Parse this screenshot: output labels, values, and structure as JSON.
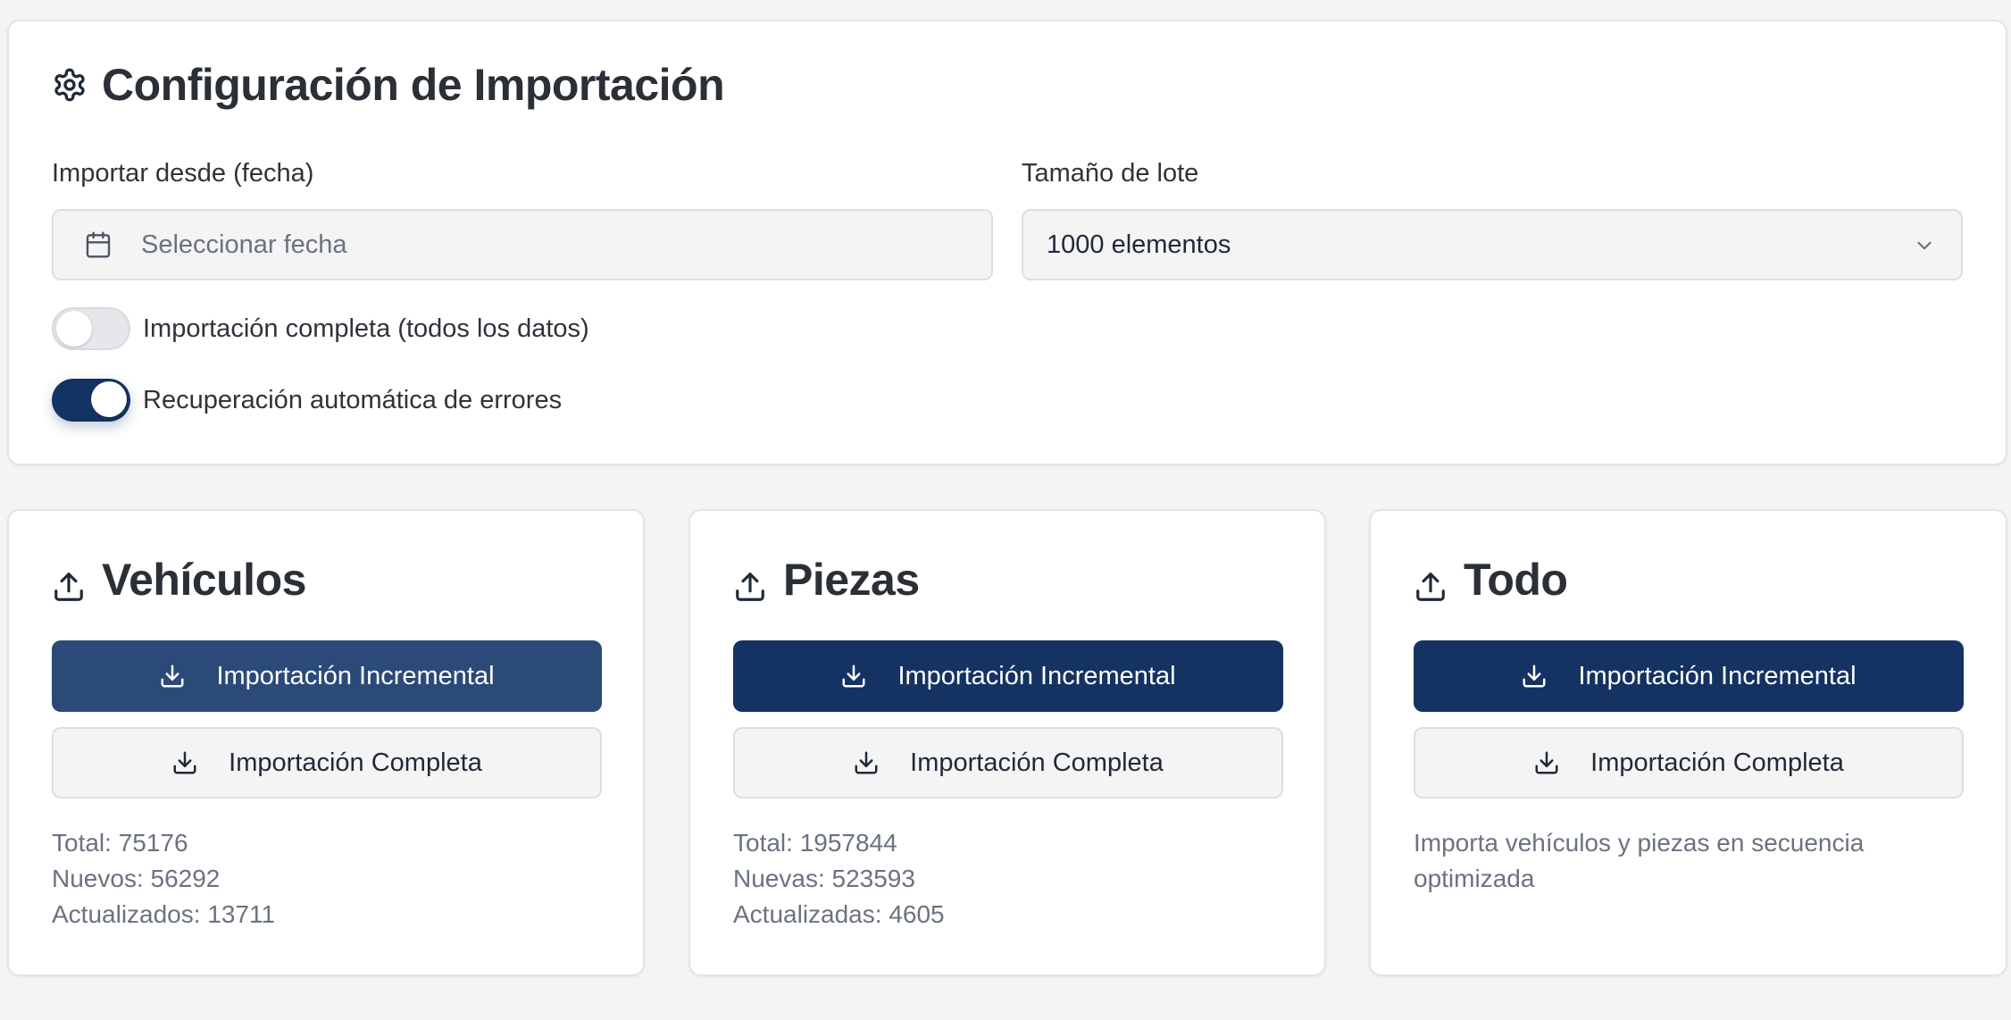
{
  "config": {
    "title": "Configuración de Importación",
    "date_label": "Importar desde (fecha)",
    "date_placeholder": "Seleccionar fecha",
    "batch_label": "Tamaño de lote",
    "batch_value": "1000 elementos",
    "toggle_full": {
      "label": "Importación completa (todos los datos)",
      "on": false
    },
    "toggle_recovery": {
      "label": "Recuperación automática de errores",
      "on": true
    }
  },
  "cards": {
    "vehiculos": {
      "title": "Vehículos",
      "incremental_label": "Importación Incremental",
      "full_label": "Importación Completa",
      "stats": [
        "Total: 75176",
        "Nuevos: 56292",
        "Actualizados: 13711"
      ]
    },
    "piezas": {
      "title": "Piezas",
      "incremental_label": "Importación Incremental",
      "full_label": "Importación Completa",
      "stats": [
        "Total: 1957844",
        "Nuevas: 523593",
        "Actualizadas: 4605"
      ]
    },
    "todo": {
      "title": "Todo",
      "incremental_label": "Importación Incremental",
      "full_label": "Importación Completa",
      "description": "Importa vehículos y piezas en secuencia optimizada"
    }
  },
  "colors": {
    "primary": "#143262",
    "primary_hover": "#2b4a78",
    "page_bg": "#f3f4f6"
  },
  "icons": {
    "settings": "gear-icon",
    "calendar": "calendar-icon",
    "dropdown": "chevron-down-icon",
    "upload": "upload-icon",
    "download": "download-icon"
  }
}
